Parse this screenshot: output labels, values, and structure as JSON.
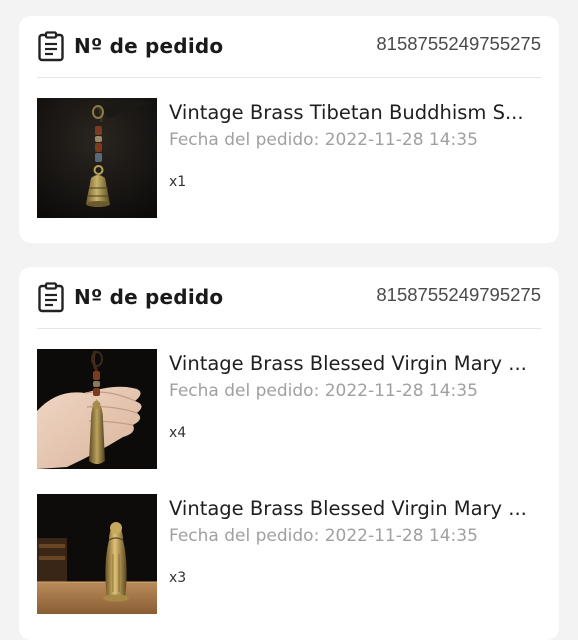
{
  "orders": [
    {
      "label": "Nº de pedido",
      "number": "8158755249755275",
      "items": [
        {
          "title": "Vintage Brass Tibetan Buddhism S...",
          "date": "Fecha del pedido: 2022-11-28 14:35",
          "qty": "x1",
          "image": "brass-tibetan-bell-keychain"
        }
      ]
    },
    {
      "label": "Nº de pedido",
      "number": "8158755249795275",
      "items": [
        {
          "title": "Vintage Brass Blessed Virgin Mary ...",
          "date": "Fecha del pedido: 2022-11-28 14:35",
          "qty": "x4",
          "image": "virgin-mary-keychain-in-hand"
        },
        {
          "title": "Vintage Brass Blessed Virgin Mary ...",
          "date": "Fecha del pedido: 2022-11-28 14:35",
          "qty": "x3",
          "image": "virgin-mary-brass-figurine"
        }
      ]
    }
  ],
  "icons": {
    "header": "clipboard-icon"
  },
  "colors": {
    "background": "#f3f3f3",
    "card": "#ffffff",
    "title": "#1f1f1f",
    "secondary": "#a0a0a0"
  }
}
